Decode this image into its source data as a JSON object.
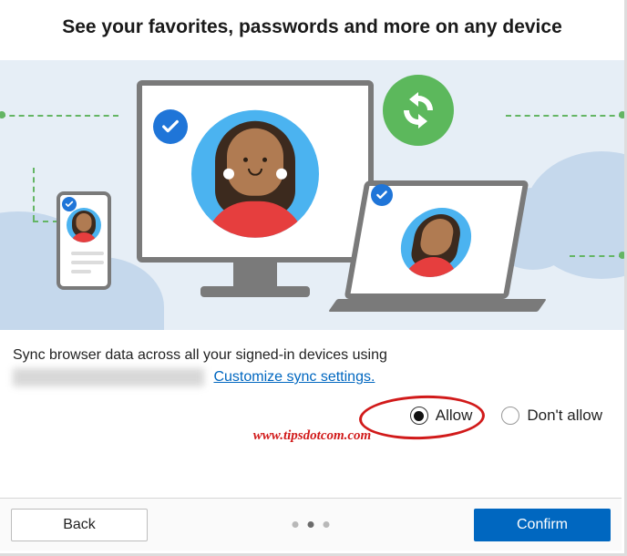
{
  "heading": "See your favorites, passwords and more on any device",
  "description": "Sync browser data across all your signed-in devices using",
  "customize_link": "Customize sync settings.",
  "radios": {
    "allow": "Allow",
    "dont_allow": "Don't allow",
    "selected": "allow"
  },
  "watermark": "www.tipsdotcom.com",
  "buttons": {
    "back": "Back",
    "confirm": "Confirm"
  },
  "pager": {
    "count": 3,
    "active_index": 1
  },
  "icons": {
    "check": "checkmark-icon",
    "sync": "sync-icon"
  }
}
